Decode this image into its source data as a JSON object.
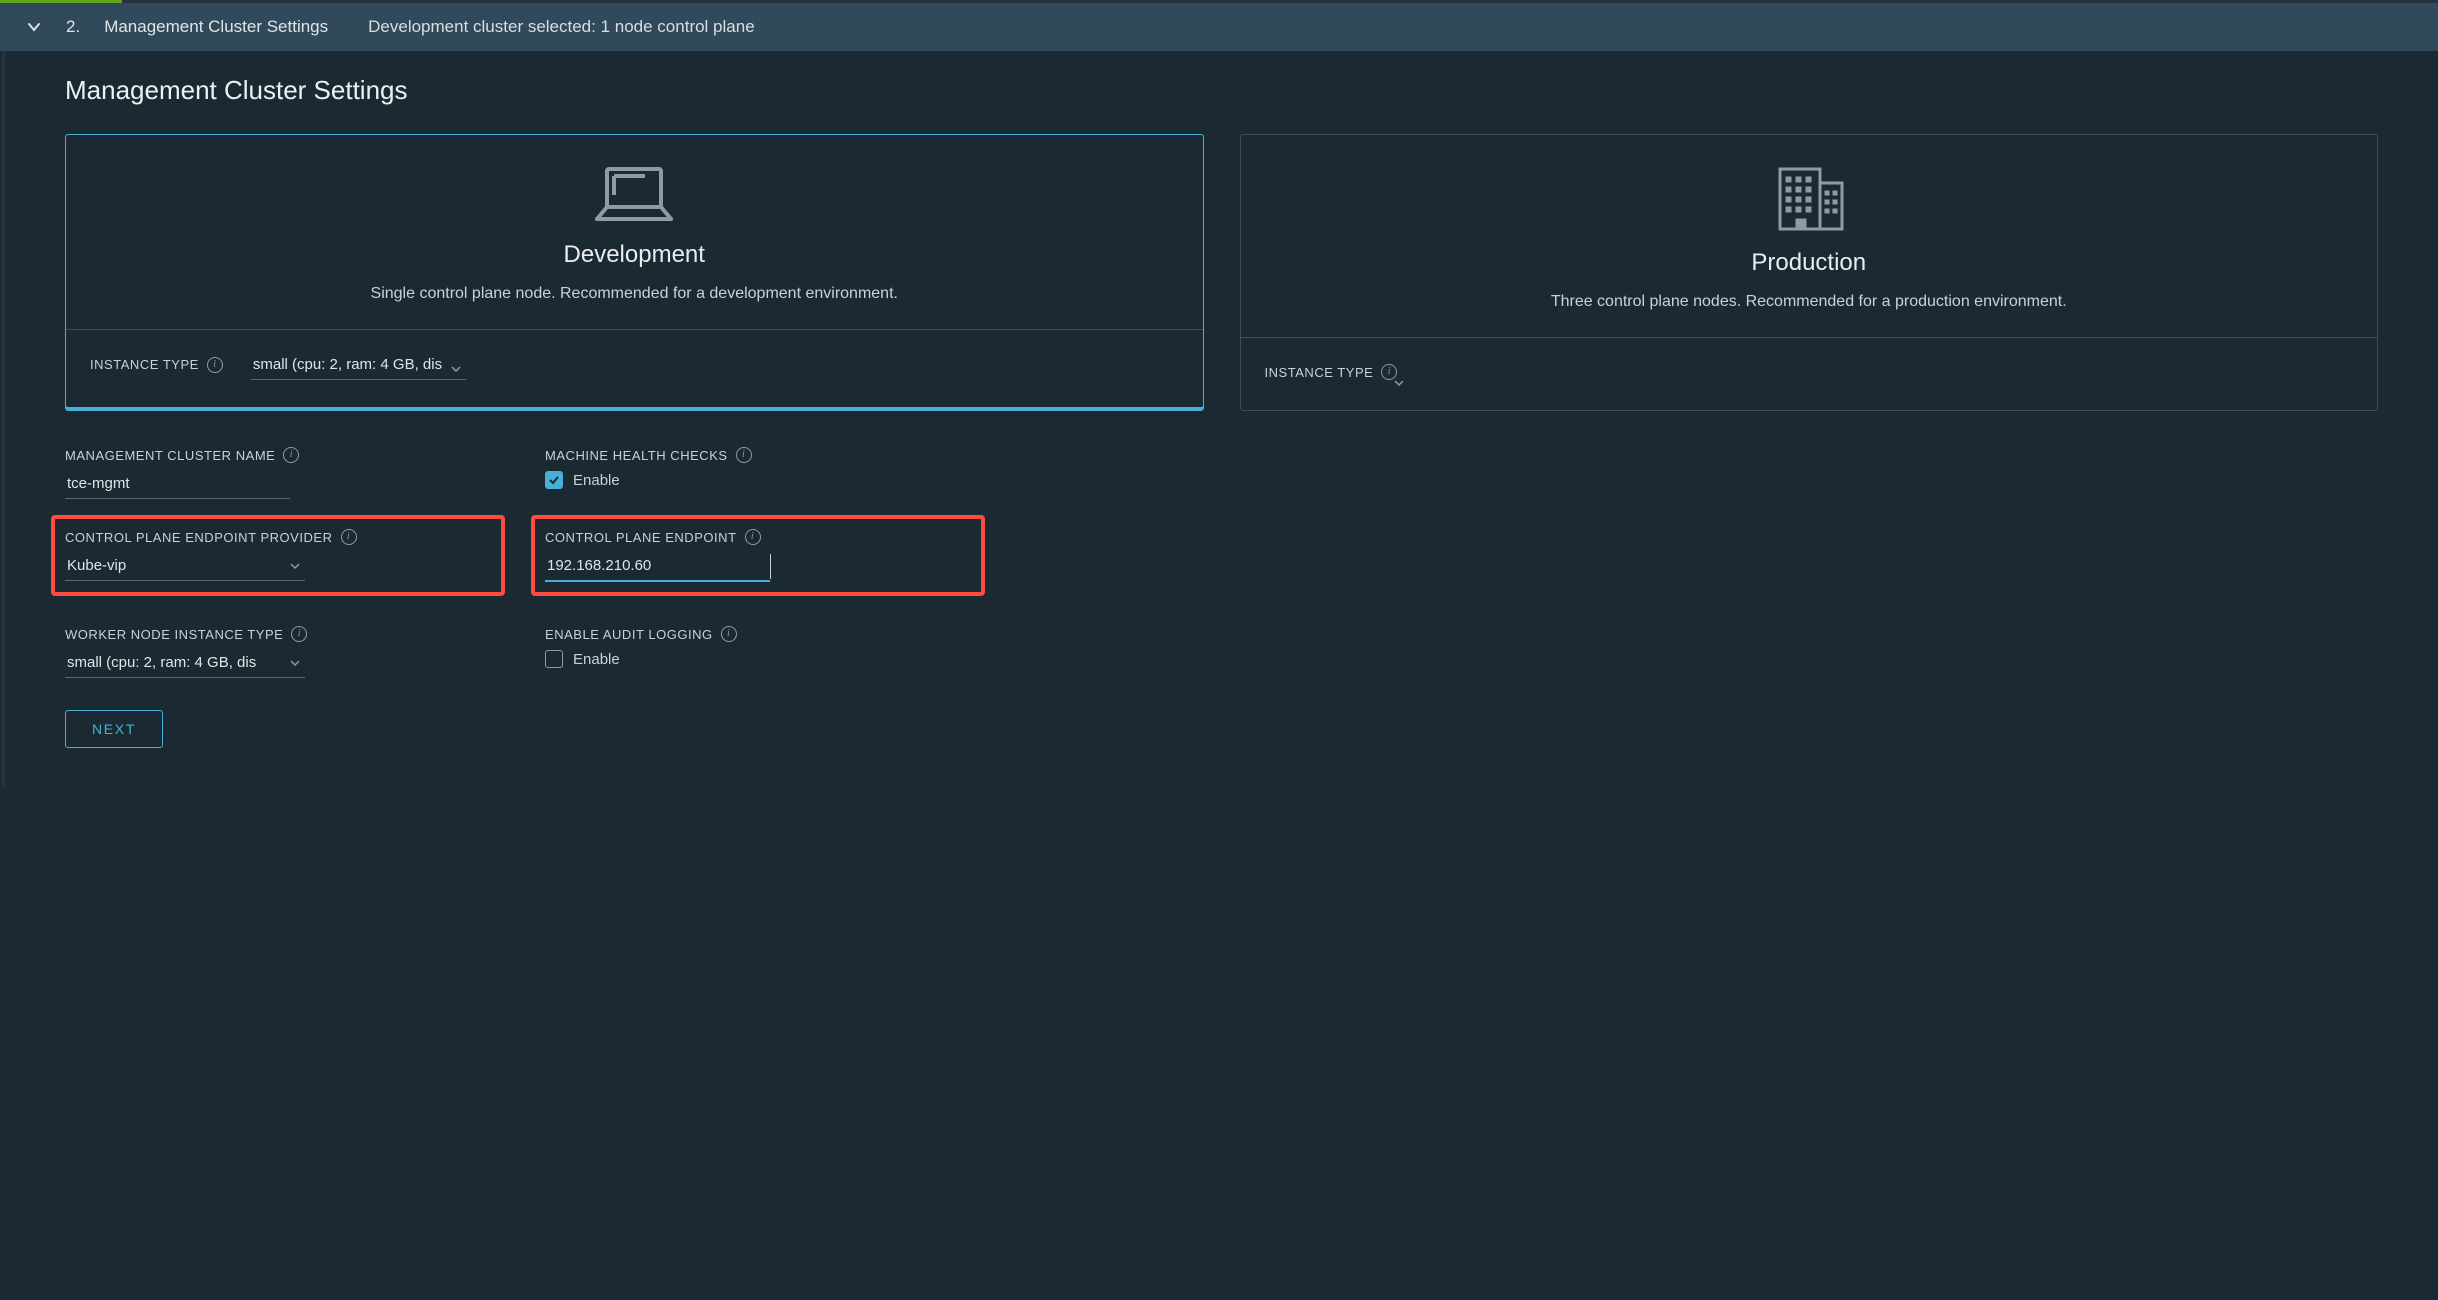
{
  "header": {
    "step_number": "2.",
    "step_title": "Management Cluster Settings",
    "summary": "Development cluster selected: 1 node control plane"
  },
  "page": {
    "title": "Management Cluster Settings"
  },
  "cards": {
    "dev": {
      "title": "Development",
      "description": "Single control plane node. Recommended for a development environment.",
      "instance_type_label": "INSTANCE TYPE",
      "instance_type_value": "small (cpu: 2, ram: 4 GB, dis"
    },
    "prod": {
      "title": "Production",
      "description": "Three control plane nodes. Recommended for a production environment.",
      "instance_type_label": "INSTANCE TYPE",
      "instance_type_value": ""
    }
  },
  "form": {
    "cluster_name": {
      "label": "MANAGEMENT CLUSTER NAME",
      "value": "tce-mgmt"
    },
    "mhc": {
      "label": "MACHINE HEALTH CHECKS",
      "enable_label": "Enable",
      "checked": true
    },
    "cp_provider": {
      "label": "CONTROL PLANE ENDPOINT PROVIDER",
      "value": "Kube-vip"
    },
    "cp_endpoint": {
      "label": "CONTROL PLANE ENDPOINT",
      "value": "192.168.210.60"
    },
    "worker": {
      "label": "WORKER NODE INSTANCE TYPE",
      "value": "small (cpu: 2, ram: 4 GB, dis"
    },
    "audit": {
      "label": "ENABLE AUDIT LOGGING",
      "enable_label": "Enable",
      "checked": false
    }
  },
  "buttons": {
    "next": "NEXT"
  }
}
